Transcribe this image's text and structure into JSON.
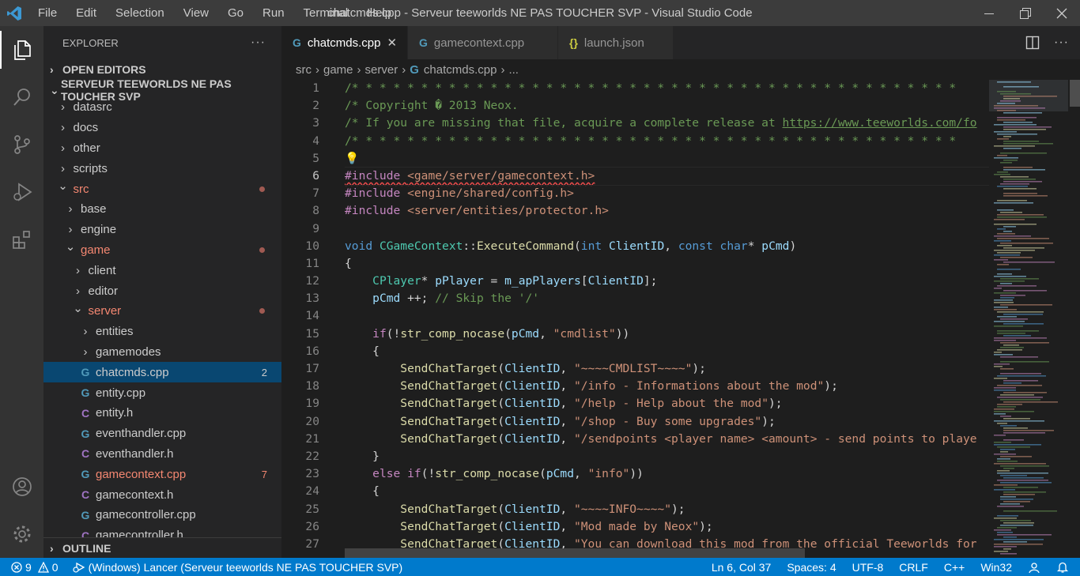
{
  "title_bar": {
    "menus": [
      "File",
      "Edit",
      "Selection",
      "View",
      "Go",
      "Run",
      "Terminal",
      "Help"
    ],
    "window_title": "chatcmds.cpp - Serveur teeworlds NE PAS TOUCHER SVP - Visual Studio Code"
  },
  "activity_bar": {
    "items": [
      "explorer-icon",
      "search-icon",
      "source-control-icon",
      "run-debug-icon",
      "extensions-icon"
    ],
    "bottom_items": [
      "account-icon",
      "gear-icon"
    ]
  },
  "sidebar": {
    "header": "EXPLORER",
    "more": "···",
    "open_editors": "OPEN EDITORS",
    "workspace": "SERVEUR TEEWORLDS NE PAS TOUCHER SVP",
    "outline": "OUTLINE",
    "tree": [
      {
        "label": "datasrc",
        "kind": "folder",
        "open": false,
        "depth": 1
      },
      {
        "label": "docs",
        "kind": "folder",
        "open": false,
        "depth": 1
      },
      {
        "label": "other",
        "kind": "folder",
        "open": false,
        "depth": 1
      },
      {
        "label": "scripts",
        "kind": "folder",
        "open": false,
        "depth": 1
      },
      {
        "label": "src",
        "kind": "folder",
        "open": true,
        "depth": 1,
        "modified": true
      },
      {
        "label": "base",
        "kind": "folder",
        "open": false,
        "depth": 2
      },
      {
        "label": "engine",
        "kind": "folder",
        "open": false,
        "depth": 2
      },
      {
        "label": "game",
        "kind": "folder",
        "open": true,
        "depth": 2,
        "modified": true
      },
      {
        "label": "client",
        "kind": "folder",
        "open": false,
        "depth": 3
      },
      {
        "label": "editor",
        "kind": "folder",
        "open": false,
        "depth": 3
      },
      {
        "label": "server",
        "kind": "folder",
        "open": true,
        "depth": 3,
        "modified": true
      },
      {
        "label": "entities",
        "kind": "folder",
        "open": false,
        "depth": 4
      },
      {
        "label": "gamemodes",
        "kind": "folder",
        "open": false,
        "depth": 4
      },
      {
        "label": "chatcmds.cpp",
        "kind": "cpp",
        "depth": 4,
        "selected": true,
        "badge": "2"
      },
      {
        "label": "entity.cpp",
        "kind": "cpp",
        "depth": 4
      },
      {
        "label": "entity.h",
        "kind": "h",
        "depth": 4
      },
      {
        "label": "eventhandler.cpp",
        "kind": "cpp",
        "depth": 4
      },
      {
        "label": "eventhandler.h",
        "kind": "h",
        "depth": 4
      },
      {
        "label": "gamecontext.cpp",
        "kind": "cpp",
        "depth": 4,
        "error": true,
        "badge": "7"
      },
      {
        "label": "gamecontext.h",
        "kind": "h",
        "depth": 4
      },
      {
        "label": "gamecontroller.cpp",
        "kind": "cpp",
        "depth": 4
      },
      {
        "label": "gamecontroller.h",
        "kind": "h",
        "depth": 4
      }
    ]
  },
  "editor": {
    "tabs": [
      {
        "label": "chatcmds.cpp",
        "icon": "cpp",
        "active": true
      },
      {
        "label": "gamecontext.cpp",
        "icon": "cpp",
        "active": false
      },
      {
        "label": "launch.json",
        "icon": "json",
        "active": false
      }
    ],
    "breadcrumb": [
      "src",
      "game",
      "server",
      "chatcmds.cpp",
      "..."
    ],
    "line_numbers": [
      "1",
      "2",
      "3",
      "4",
      "5",
      "6",
      "7",
      "8",
      "9",
      "10",
      "11",
      "12",
      "13",
      "14",
      "15",
      "16",
      "17",
      "18",
      "19",
      "20",
      "21",
      "22",
      "23",
      "24",
      "25",
      "26",
      "27"
    ]
  },
  "status_bar": {
    "errors": "9",
    "warnings": "0",
    "debug": "(Windows) Lancer (Serveur teeworlds NE PAS TOUCHER SVP)",
    "position": "Ln 6, Col 37",
    "spaces": "Spaces: 4",
    "encoding": "UTF-8",
    "eol": "CRLF",
    "language": "C++",
    "platform": "Win32"
  },
  "colors": {
    "accent": "#007acc",
    "selection": "#094771",
    "git_modified": "#f48771"
  }
}
